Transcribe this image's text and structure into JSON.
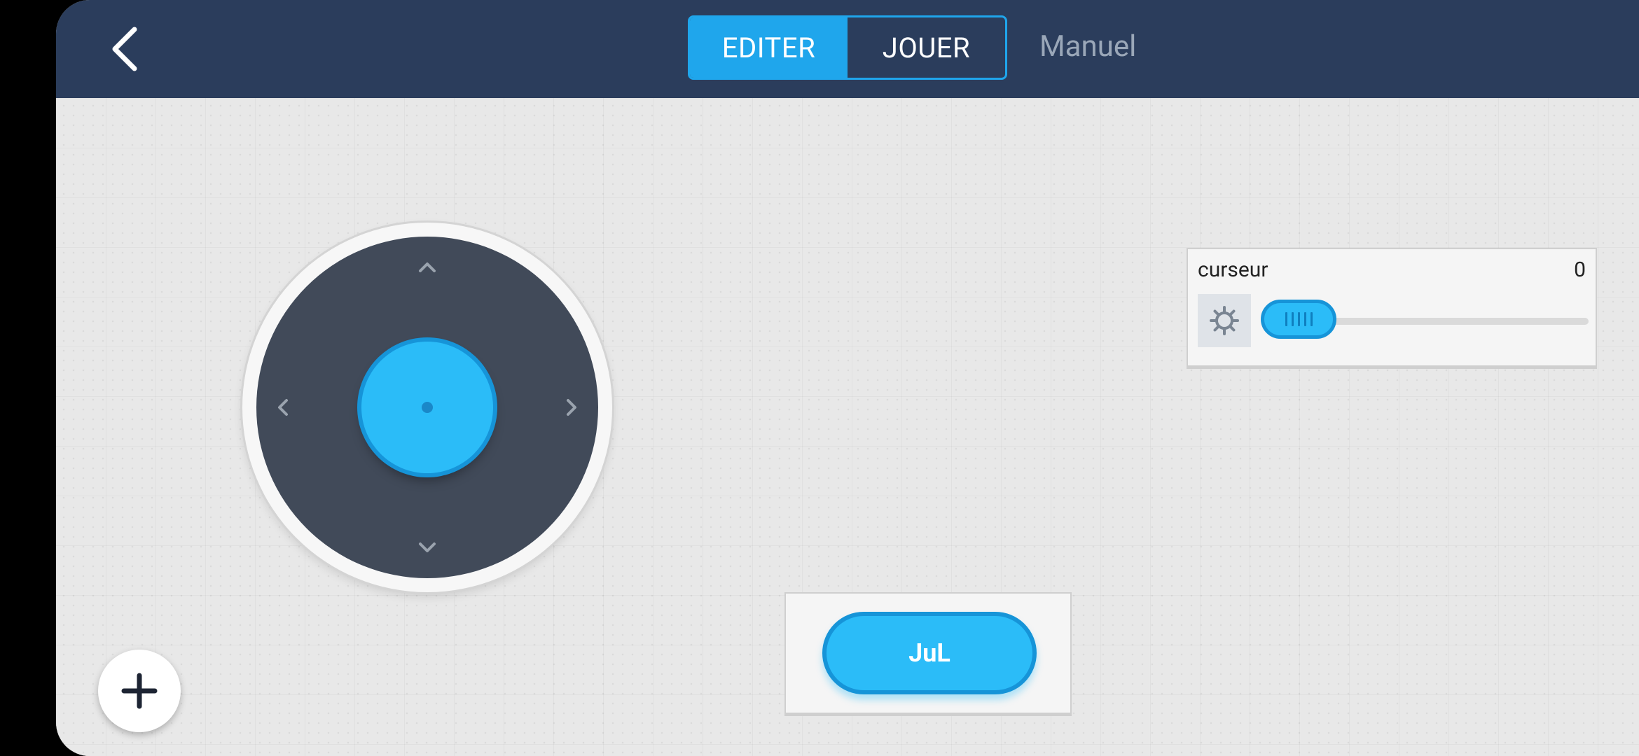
{
  "header": {
    "back_icon": "chevron-left-icon",
    "tabs": [
      {
        "label": "EDITER",
        "active": true
      },
      {
        "label": "JOUER",
        "active": false
      }
    ],
    "manual_link": "Manuel"
  },
  "colors": {
    "header_bg": "#2b3d5c",
    "accent": "#1fa6ec",
    "widget_blue": "#2bbcf8",
    "joystick_pad": "#414a59"
  },
  "joystick": {
    "icons": [
      "chevron-up-icon",
      "chevron-down-icon",
      "chevron-left-icon",
      "chevron-right-icon"
    ]
  },
  "slider": {
    "label": "curseur",
    "value": "0",
    "fraction": 0,
    "settings_icon": "gear-icon"
  },
  "action_button": {
    "label": "JuL"
  },
  "fab": {
    "icon": "plus-icon"
  }
}
